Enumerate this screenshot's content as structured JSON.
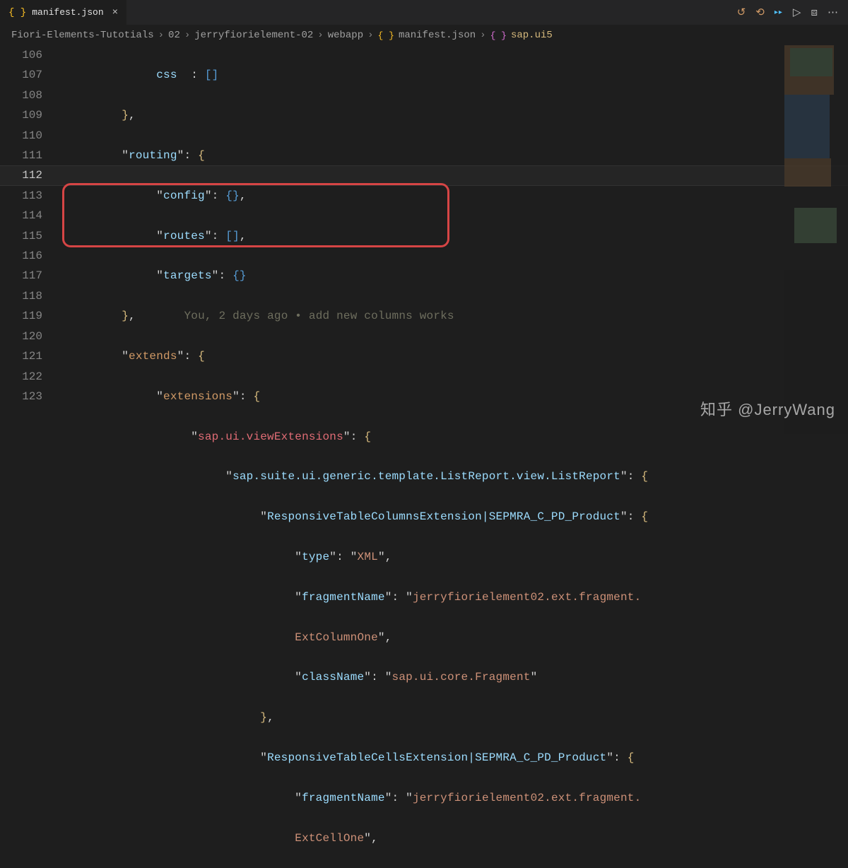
{
  "tab": {
    "icon_label": "{ }",
    "name": "manifest.json",
    "close": "×"
  },
  "toolbar": {
    "history": "↺",
    "revert": "⟲",
    "compare": "▸▸",
    "run": "▷",
    "split": "⧈",
    "more": "⋯"
  },
  "breadcrumbs": [
    "Fiori-Elements-Tutotials",
    "02",
    "jerryfiorielement-02",
    "webapp",
    "manifest.json",
    "sap.ui5"
  ],
  "gutter": [
    "106",
    "107",
    "108",
    "109",
    "110",
    "111",
    "112",
    "113",
    "114",
    "115",
    "116",
    "117",
    "118",
    "119",
    "",
    "120",
    "121",
    "122",
    "123",
    ""
  ],
  "current_line_index": 6,
  "code": {
    "l106": "        \"css\": []",
    "l107": "    },",
    "k_routing": "routing",
    "k_config": "config",
    "k_routes": "routes",
    "k_targets": "targets",
    "lens": "You, 2 days ago • add new columns works",
    "k_extends": "extends",
    "k_extensions": "extensions",
    "k_viewext": "sap.ui.viewExtensions",
    "k_listreport": "sap.suite.ui.generic.template.ListReport.view.ListReport",
    "k_respcols": "ResponsiveTableColumnsExtension|SEPMRA_C_PD_Product",
    "k_type": "type",
    "v_type": "XML",
    "k_fragname": "fragmentName",
    "v_fragname1": "jerryfiorielement02.ext.fragment.",
    "v_fragname1b": "ExtColumnOne",
    "k_classname": "className",
    "v_classname": "sap.ui.core.Fragment",
    "k_respcells": "ResponsiveTableCellsExtension|SEPMRA_C_PD_Product",
    "v_fragname2": "jerryfiorielement02.ext.fragment.",
    "v_fragname2b": "ExtCellOne"
  },
  "watermark": "知乎 @JerryWang"
}
